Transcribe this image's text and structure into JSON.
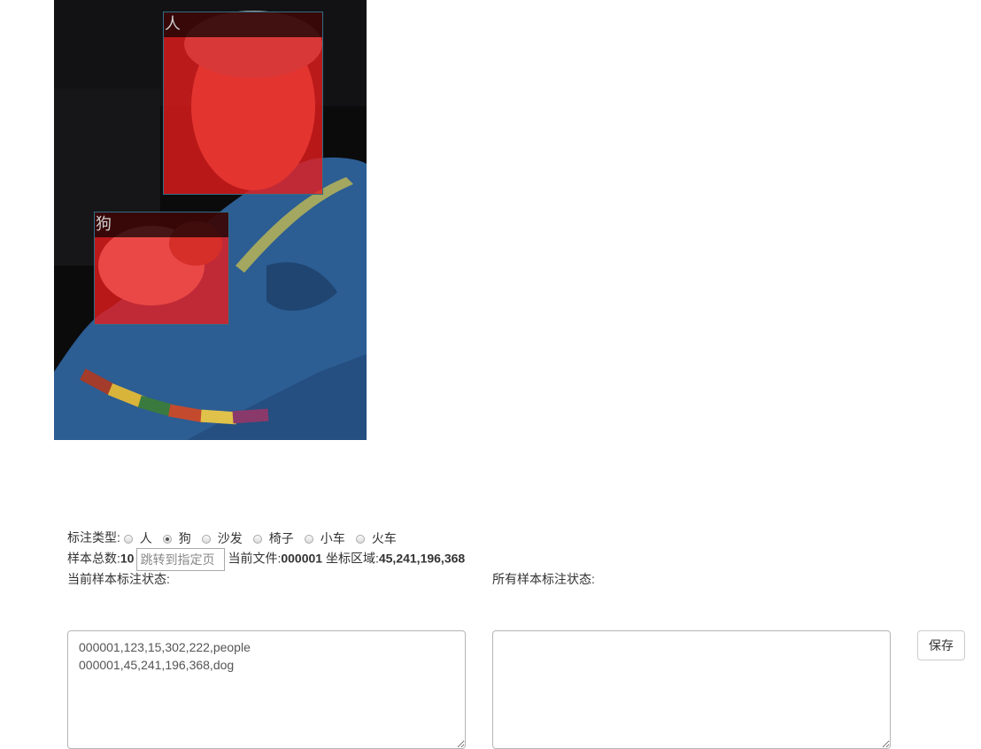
{
  "image": {
    "annotations": [
      {
        "label": "人"
      },
      {
        "label": "狗"
      }
    ]
  },
  "controls": {
    "type_label": "标注类型:",
    "types": [
      "人",
      "狗",
      "沙发",
      "椅子",
      "小车",
      "火车"
    ],
    "selected_type": "狗",
    "total_label": "样本总数:",
    "total_value": "10",
    "jump_placeholder": "跳转到指定页",
    "current_file_label": "当前文件:",
    "current_file_value": "000001",
    "coord_label": "坐标区域:",
    "coord_value": "45,241,196,368"
  },
  "panels": {
    "current_label": "当前样本标注状态:",
    "current_text": "000001,123,15,302,222,people\n000001,45,241,196,368,dog",
    "all_label": "所有样本标注状态:",
    "all_text": "",
    "save_label": "保存"
  },
  "colors": {
    "bbox_fill": "#eb1c1c",
    "bbox_border": "#2f6f86",
    "sweater": "#2c5d93"
  }
}
